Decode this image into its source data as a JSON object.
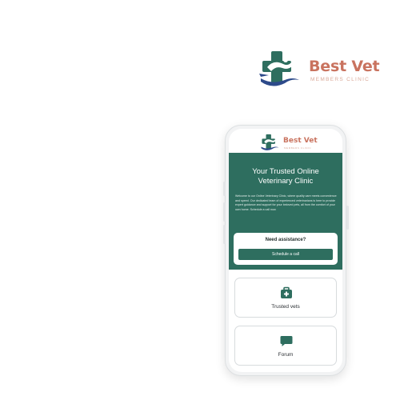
{
  "brand": {
    "name": "Best Vet",
    "subtitle": "MEMBERS CLINIC",
    "colors": {
      "primary": "#2e6e5f",
      "accent": "#c9735f",
      "navy": "#2d4a8a"
    }
  },
  "phone_screen": {
    "header": {
      "logo_name": "Best Vet",
      "logo_subtitle": "MEMBERS CLINIC"
    },
    "hero": {
      "title_line1": "Your Trusted Online",
      "title_line2": "Veterinary Clinic",
      "description": "Welcome to our Online Veterinary Clinic, where quality care meets convenience and speed. Our dedicated team of experienced veterinarians is here to provide expert guidance and support for your beloved pets, all from the comfort of your own home. Schedule a call now."
    },
    "assistance": {
      "title": "Need assistance?",
      "button_label": "Schedule a call"
    },
    "features": [
      {
        "label": "Trusted vets",
        "icon": "medical-kit-icon"
      },
      {
        "label": "Forum",
        "icon": "chat-bubble-icon"
      }
    ]
  }
}
